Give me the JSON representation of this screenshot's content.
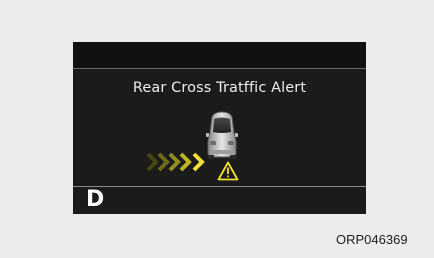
{
  "display": {
    "alert_title": "Rear Cross Tratffic Alert",
    "gear": "D"
  },
  "figure_code": "ORP046369",
  "icons": {
    "vehicle": "rear-view-car-icon",
    "approach": "approaching-chevrons-icon",
    "warning": "warning-triangle-icon"
  },
  "colors": {
    "screen": "#1b1b1b",
    "alert_yellow": "#f0e130",
    "text": "#ececec"
  }
}
